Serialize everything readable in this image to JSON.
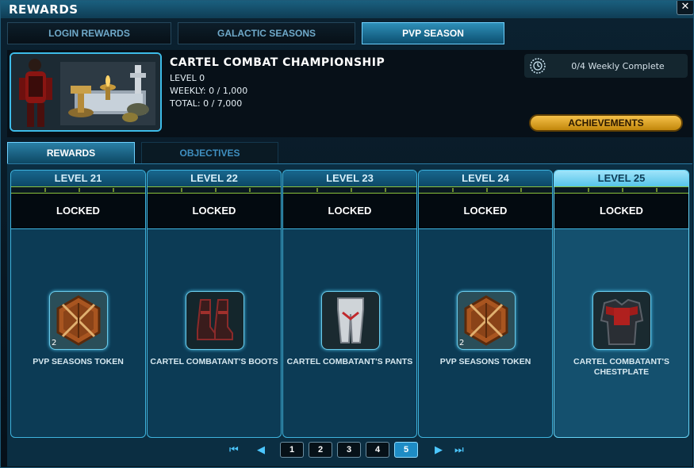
{
  "window": {
    "title": "REWARDS",
    "close_glyph": "✕"
  },
  "main_tabs": [
    {
      "label": "LOGIN REWARDS",
      "active": false
    },
    {
      "label": "GALACTIC SEASONS",
      "active": false
    },
    {
      "label": "PVP SEASON",
      "active": true
    }
  ],
  "header": {
    "title": "CARTEL COMBAT CHAMPIONSHIP",
    "level": "LEVEL 0",
    "weekly": "WEEKLY: 0 / 1,000",
    "total": "TOTAL: 0 / 7,000",
    "weekly_complete": "0/4 Weekly Complete",
    "achievements_label": "ACHIEVEMENTS"
  },
  "sub_tabs": [
    {
      "label": "REWARDS",
      "active": true
    },
    {
      "label": "OBJECTIVES",
      "active": false
    }
  ],
  "rewards": [
    {
      "level": "LEVEL 21",
      "status": "LOCKED",
      "item": "PVP SEASONS TOKEN",
      "qty": "2",
      "icon": "pvp-token-icon",
      "highlight": false
    },
    {
      "level": "LEVEL 22",
      "status": "LOCKED",
      "item": "CARTEL COMBATANT'S BOOTS",
      "qty": "",
      "icon": "boots-icon",
      "highlight": false
    },
    {
      "level": "LEVEL 23",
      "status": "LOCKED",
      "item": "CARTEL COMBATANT'S PANTS",
      "qty": "",
      "icon": "pants-icon",
      "highlight": false
    },
    {
      "level": "LEVEL 24",
      "status": "LOCKED",
      "item": "PVP SEASONS TOKEN",
      "qty": "2",
      "icon": "pvp-token-icon",
      "highlight": false
    },
    {
      "level": "LEVEL 25",
      "status": "LOCKED",
      "item": "CARTEL COMBATANT'S CHESTPLATE",
      "qty": "",
      "icon": "chestplate-icon",
      "highlight": true
    }
  ],
  "pagination": {
    "pages": [
      "1",
      "2",
      "3",
      "4",
      "5"
    ],
    "current": "5"
  },
  "colors": {
    "accent": "#3eb3dd",
    "achievement_gold": "#e0a826",
    "progress_green": "#8ac33d"
  }
}
